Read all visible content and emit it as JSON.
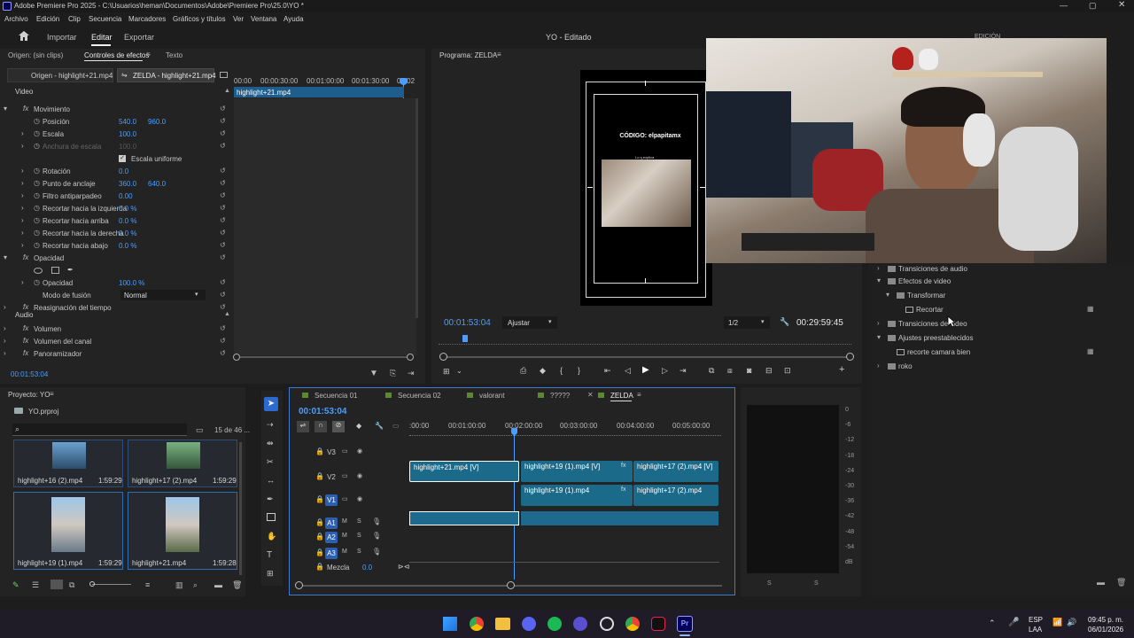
{
  "titlebar": {
    "title": "Adobe Premiere Pro 2025 - C:\\Usuarios\\heman\\Documentos\\Adobe\\Premiere Pro\\25.0\\YO *"
  },
  "menubar": [
    "Archivo",
    "Edición",
    "Clip",
    "Secuencia",
    "Marcadores",
    "Gráficos y títulos",
    "Ver",
    "Ventana",
    "Ayuda"
  ],
  "workspace": {
    "tabs": [
      "Importar",
      "Editar",
      "Exportar"
    ],
    "active": "Editar",
    "project_status": "YO - Editado",
    "edicion": "EDICIÓN"
  },
  "source_panel": {
    "tabs": [
      "Origen: (sin clips)",
      "Controles de efectos",
      "Texto"
    ],
    "clip_tabs": [
      "Origen - highlight+21.mp4",
      "ZELDA - highlight+21.mp4"
    ],
    "ruler": [
      "00:00",
      "00:00:30:00",
      "00:01:00:00",
      "00:01:30:00",
      "00:02"
    ],
    "clip_label": "highlight+21.mp4",
    "timecode": "00:01:53:04",
    "sections": {
      "video": "Video",
      "audio": "Audio"
    },
    "rows": [
      {
        "label": "Movimiento"
      },
      {
        "label": "Posición",
        "v1": "540.0",
        "v2": "960.0"
      },
      {
        "label": "Escala",
        "v1": "100.0"
      },
      {
        "label": "Anchura de escala",
        "v1": "100.0"
      },
      {
        "label": "Escala uniforme"
      },
      {
        "label": "Rotación",
        "v1": "0.0"
      },
      {
        "label": "Punto de anclaje",
        "v1": "360.0",
        "v2": "640.0"
      },
      {
        "label": "Filtro antiparpadeo",
        "v1": "0.00"
      },
      {
        "label": "Recortar hacia la izquierda",
        "v1": "0.0 %"
      },
      {
        "label": "Recortar hacia arriba",
        "v1": "0.0 %"
      },
      {
        "label": "Recortar hacia la derecha",
        "v1": "0.0 %"
      },
      {
        "label": "Recortar hacia abajo",
        "v1": "0.0 %"
      },
      {
        "label": "Opacidad"
      },
      {
        "label": "Opacidad",
        "v1": "100.0 %"
      },
      {
        "label": "Modo de fusión",
        "v1": "Normal"
      },
      {
        "label": "Reasignación del tiempo"
      },
      {
        "label": "Volumen"
      },
      {
        "label": "Volumen del canal"
      },
      {
        "label": "Panoramizador"
      }
    ]
  },
  "program": {
    "title": "Programa: ZELDA",
    "overlay_text": "CÓDIGO: elpapitamx",
    "overlay_small": "Lo q explica",
    "timecode": "00:01:53:04",
    "fit": "Ajustar",
    "quality": "1/2",
    "duration": "00:29:59:45"
  },
  "effects": {
    "items": [
      {
        "label": "Transiciones de audio",
        "indent": 0
      },
      {
        "label": "Efectos de video",
        "indent": 0
      },
      {
        "label": "Transformar",
        "indent": 1
      },
      {
        "label": "Recortar",
        "indent": 2
      },
      {
        "label": "Transiciones de video",
        "indent": 0
      },
      {
        "label": "Ajustes preestablecidos",
        "indent": 0
      },
      {
        "label": "recorte camara bien",
        "indent": 1
      },
      {
        "label": "roko",
        "indent": 0
      }
    ]
  },
  "project": {
    "title": "Proyecto: YO",
    "file": "YO.prproj",
    "count": "15 de 46 ...",
    "items": [
      {
        "name": "highlight+16 (2).mp4",
        "dur": "1:59:29"
      },
      {
        "name": "highlight+17 (2).mp4",
        "dur": "1:59:29"
      },
      {
        "name": "highlight+19 (1).mp4",
        "dur": "1:59:29"
      },
      {
        "name": "highlight+21.mp4",
        "dur": "1:59:28"
      }
    ]
  },
  "timeline": {
    "tabs": [
      "Secuencia 01",
      "Secuencia 02",
      "valorant",
      "?????",
      "ZELDA"
    ],
    "timecode": "00:01:53:04",
    "ruler": [
      ":00:00",
      "00:01:00:00",
      "00:02:00:00",
      "00:03:00:00",
      "00:04:00:00",
      "00:05:00:00"
    ],
    "tracks": [
      "V3",
      "V2",
      "V1",
      "A1",
      "A2",
      "A3"
    ],
    "mix_label": "Mezcla",
    "mix_value": "0.0",
    "clips_v2": [
      "highlight+21.mp4 [V]",
      "highlight+19 (1).mp4 [V]",
      "highlight+17 (2).mp4 [V]"
    ],
    "clips_v1": [
      "highlight+19 (1).mp4",
      "highlight+17 (2).mp4"
    ]
  },
  "meter": {
    "scale": [
      "0",
      "-6",
      "-12",
      "-18",
      "-24",
      "-30",
      "-36",
      "-42",
      "-48",
      "-54",
      "dB"
    ],
    "channels": [
      "S",
      "S"
    ]
  },
  "taskbar": {
    "lang": "ESP",
    "region": "LAA",
    "time": "09:45 p. m.",
    "date": "06/01/2026"
  }
}
